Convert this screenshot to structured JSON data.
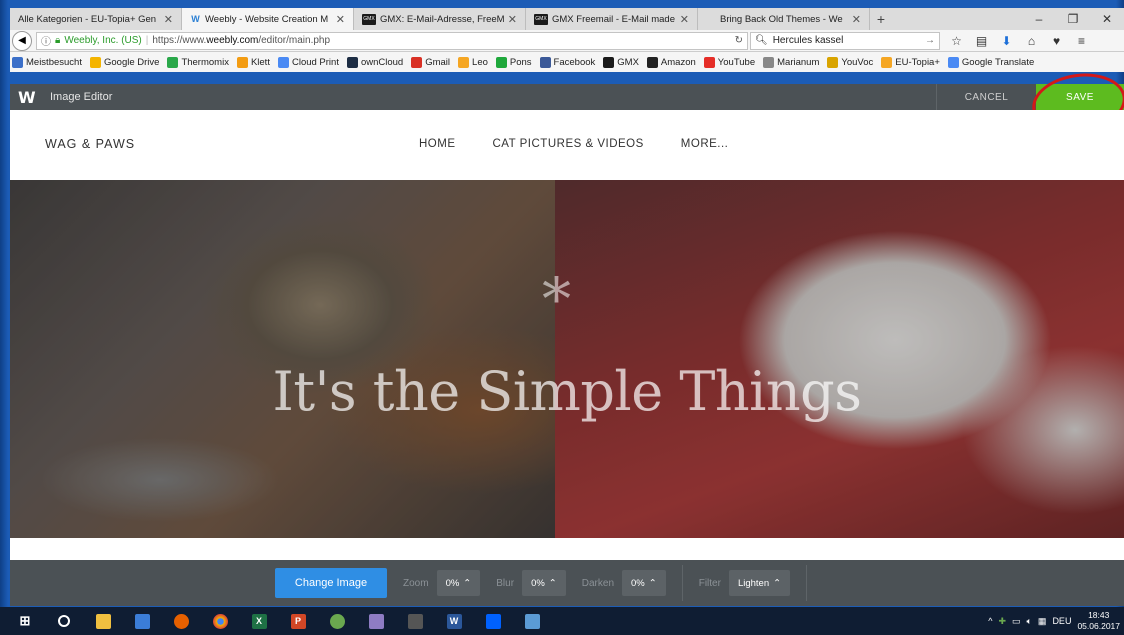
{
  "browser": {
    "tabs": [
      {
        "label": "Alle Kategorien - EU-Topia+ Gen",
        "icon": "page-icon",
        "active": false
      },
      {
        "label": "Weebly - Website Creation M",
        "icon": "weebly-icon",
        "active": true
      },
      {
        "label": "GMX: E-Mail-Adresse, FreeM",
        "icon": "gmx-icon",
        "active": false
      },
      {
        "label": "GMX Freemail - E-Mail made",
        "icon": "gmx-icon",
        "active": false
      },
      {
        "label": "Bring Back Old Themes - We",
        "icon": "page-icon",
        "active": false
      }
    ],
    "new_tab": "+",
    "window_controls": {
      "minimize": "–",
      "restore": "❐",
      "close": "✕"
    },
    "address": {
      "org": "Weebly, Inc. (US)",
      "url_prefix": "https://www.",
      "url_domain": "weebly.com",
      "url_path": "/editor/main.php"
    },
    "search": {
      "value": "Hercules kassel"
    },
    "bookmarks": [
      {
        "label": "Meistbesucht",
        "color": "#3b6fc8"
      },
      {
        "label": "Google Drive",
        "color": "#f4b400"
      },
      {
        "label": "Thermomix",
        "color": "#2aa84a"
      },
      {
        "label": "Klett",
        "color": "#f39c12"
      },
      {
        "label": "Cloud Print",
        "color": "#4a8af4"
      },
      {
        "label": "ownCloud",
        "color": "#1d2d44"
      },
      {
        "label": "Gmail",
        "color": "#d93025"
      },
      {
        "label": "Leo",
        "color": "#f5a623"
      },
      {
        "label": "Pons",
        "color": "#1fa83b"
      },
      {
        "label": "Facebook",
        "color": "#3b5998"
      },
      {
        "label": "GMX",
        "color": "#1a1a1a"
      },
      {
        "label": "Amazon",
        "color": "#222222"
      },
      {
        "label": "YouTube",
        "color": "#e52d27"
      },
      {
        "label": "Marianum",
        "color": "#888888"
      },
      {
        "label": "YouVoc",
        "color": "#d9a400"
      },
      {
        "label": "EU-Topia+",
        "color": "#f5a623"
      },
      {
        "label": "Google Translate",
        "color": "#4a8af4"
      }
    ]
  },
  "editor": {
    "logo": "W",
    "title": "Image Editor",
    "cancel_label": "CANCEL",
    "save_label": "SAVE"
  },
  "site": {
    "logo": "WAG & PAWS",
    "menu": [
      "HOME",
      "CAT PICTURES & VIDEOS",
      "MORE..."
    ],
    "hero_star": "*",
    "hero_title": "It's the Simple Things"
  },
  "toolbar": {
    "change_image": "Change Image",
    "controls": [
      {
        "label": "Zoom",
        "value": "0%"
      },
      {
        "label": "Blur",
        "value": "0%"
      },
      {
        "label": "Darken",
        "value": "0%"
      },
      {
        "label": "Filter",
        "value": "Lighten"
      }
    ]
  },
  "taskbar": {
    "language": "DEU",
    "time": "18:43",
    "date": "05.06.2017"
  },
  "colors": {
    "save_green": "#5dbb1f",
    "change_blue": "#2f8ee4",
    "editor_bar": "#4b5155",
    "annotation_red": "#d41818"
  }
}
